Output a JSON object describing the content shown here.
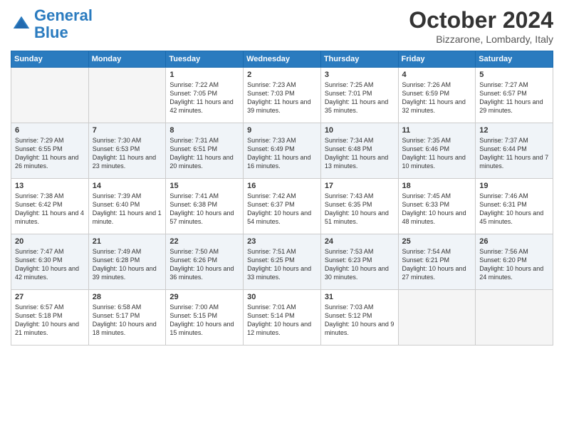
{
  "logo": {
    "line1": "General",
    "line2": "Blue"
  },
  "title": "October 2024",
  "subtitle": "Bizzarone, Lombardy, Italy",
  "headers": [
    "Sunday",
    "Monday",
    "Tuesday",
    "Wednesday",
    "Thursday",
    "Friday",
    "Saturday"
  ],
  "weeks": [
    [
      {
        "num": "",
        "info": ""
      },
      {
        "num": "",
        "info": ""
      },
      {
        "num": "1",
        "info": "Sunrise: 7:22 AM\nSunset: 7:05 PM\nDaylight: 11 hours and 42 minutes."
      },
      {
        "num": "2",
        "info": "Sunrise: 7:23 AM\nSunset: 7:03 PM\nDaylight: 11 hours and 39 minutes."
      },
      {
        "num": "3",
        "info": "Sunrise: 7:25 AM\nSunset: 7:01 PM\nDaylight: 11 hours and 35 minutes."
      },
      {
        "num": "4",
        "info": "Sunrise: 7:26 AM\nSunset: 6:59 PM\nDaylight: 11 hours and 32 minutes."
      },
      {
        "num": "5",
        "info": "Sunrise: 7:27 AM\nSunset: 6:57 PM\nDaylight: 11 hours and 29 minutes."
      }
    ],
    [
      {
        "num": "6",
        "info": "Sunrise: 7:29 AM\nSunset: 6:55 PM\nDaylight: 11 hours and 26 minutes."
      },
      {
        "num": "7",
        "info": "Sunrise: 7:30 AM\nSunset: 6:53 PM\nDaylight: 11 hours and 23 minutes."
      },
      {
        "num": "8",
        "info": "Sunrise: 7:31 AM\nSunset: 6:51 PM\nDaylight: 11 hours and 20 minutes."
      },
      {
        "num": "9",
        "info": "Sunrise: 7:33 AM\nSunset: 6:49 PM\nDaylight: 11 hours and 16 minutes."
      },
      {
        "num": "10",
        "info": "Sunrise: 7:34 AM\nSunset: 6:48 PM\nDaylight: 11 hours and 13 minutes."
      },
      {
        "num": "11",
        "info": "Sunrise: 7:35 AM\nSunset: 6:46 PM\nDaylight: 11 hours and 10 minutes."
      },
      {
        "num": "12",
        "info": "Sunrise: 7:37 AM\nSunset: 6:44 PM\nDaylight: 11 hours and 7 minutes."
      }
    ],
    [
      {
        "num": "13",
        "info": "Sunrise: 7:38 AM\nSunset: 6:42 PM\nDaylight: 11 hours and 4 minutes."
      },
      {
        "num": "14",
        "info": "Sunrise: 7:39 AM\nSunset: 6:40 PM\nDaylight: 11 hours and 1 minute."
      },
      {
        "num": "15",
        "info": "Sunrise: 7:41 AM\nSunset: 6:38 PM\nDaylight: 10 hours and 57 minutes."
      },
      {
        "num": "16",
        "info": "Sunrise: 7:42 AM\nSunset: 6:37 PM\nDaylight: 10 hours and 54 minutes."
      },
      {
        "num": "17",
        "info": "Sunrise: 7:43 AM\nSunset: 6:35 PM\nDaylight: 10 hours and 51 minutes."
      },
      {
        "num": "18",
        "info": "Sunrise: 7:45 AM\nSunset: 6:33 PM\nDaylight: 10 hours and 48 minutes."
      },
      {
        "num": "19",
        "info": "Sunrise: 7:46 AM\nSunset: 6:31 PM\nDaylight: 10 hours and 45 minutes."
      }
    ],
    [
      {
        "num": "20",
        "info": "Sunrise: 7:47 AM\nSunset: 6:30 PM\nDaylight: 10 hours and 42 minutes."
      },
      {
        "num": "21",
        "info": "Sunrise: 7:49 AM\nSunset: 6:28 PM\nDaylight: 10 hours and 39 minutes."
      },
      {
        "num": "22",
        "info": "Sunrise: 7:50 AM\nSunset: 6:26 PM\nDaylight: 10 hours and 36 minutes."
      },
      {
        "num": "23",
        "info": "Sunrise: 7:51 AM\nSunset: 6:25 PM\nDaylight: 10 hours and 33 minutes."
      },
      {
        "num": "24",
        "info": "Sunrise: 7:53 AM\nSunset: 6:23 PM\nDaylight: 10 hours and 30 minutes."
      },
      {
        "num": "25",
        "info": "Sunrise: 7:54 AM\nSunset: 6:21 PM\nDaylight: 10 hours and 27 minutes."
      },
      {
        "num": "26",
        "info": "Sunrise: 7:56 AM\nSunset: 6:20 PM\nDaylight: 10 hours and 24 minutes."
      }
    ],
    [
      {
        "num": "27",
        "info": "Sunrise: 6:57 AM\nSunset: 5:18 PM\nDaylight: 10 hours and 21 minutes."
      },
      {
        "num": "28",
        "info": "Sunrise: 6:58 AM\nSunset: 5:17 PM\nDaylight: 10 hours and 18 minutes."
      },
      {
        "num": "29",
        "info": "Sunrise: 7:00 AM\nSunset: 5:15 PM\nDaylight: 10 hours and 15 minutes."
      },
      {
        "num": "30",
        "info": "Sunrise: 7:01 AM\nSunset: 5:14 PM\nDaylight: 10 hours and 12 minutes."
      },
      {
        "num": "31",
        "info": "Sunrise: 7:03 AM\nSunset: 5:12 PM\nDaylight: 10 hours and 9 minutes."
      },
      {
        "num": "",
        "info": ""
      },
      {
        "num": "",
        "info": ""
      }
    ]
  ]
}
